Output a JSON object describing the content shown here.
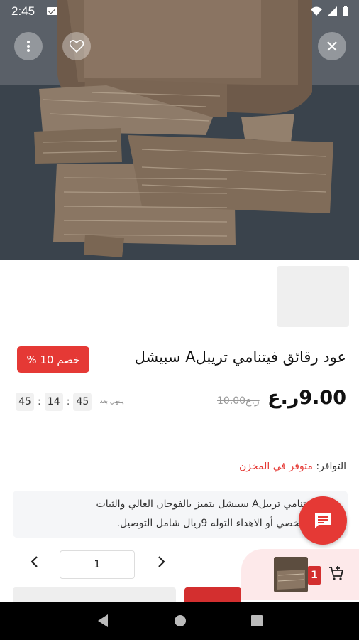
{
  "status_bar": {
    "time": "2:45"
  },
  "product": {
    "title": "عود رقائق فيتنامي تريبلA سبيشل",
    "discount_badge": "خصم 10 %",
    "price": "9.00ر.ع",
    "old_price": "10.00ر.ع",
    "countdown": {
      "ends_label": "ينتهي بعد",
      "days": "45",
      "hours": "14",
      "minutes": "45"
    },
    "availability_label": "التوافر:",
    "availability_value": "متوفر في المخزن",
    "description_line1": "رقائق فيتنامي تريبلA سبيشل يتميز بالفوحان العالي والثبات",
    "description_line2": "تخدام الشخصي أو الاهداء التوله 9ريال شامل التوصيل."
  },
  "quantity": {
    "value": "1"
  },
  "cart": {
    "count": "1"
  },
  "colors": {
    "accent": "#e53935",
    "cart_bg": "#fde9ea"
  },
  "icons": [
    "more-vertical-icon",
    "heart-icon",
    "close-icon",
    "chat-icon",
    "chevron-left-icon",
    "chevron-right-icon",
    "add-to-cart-icon",
    "back-icon",
    "home-icon",
    "recents-icon"
  ]
}
